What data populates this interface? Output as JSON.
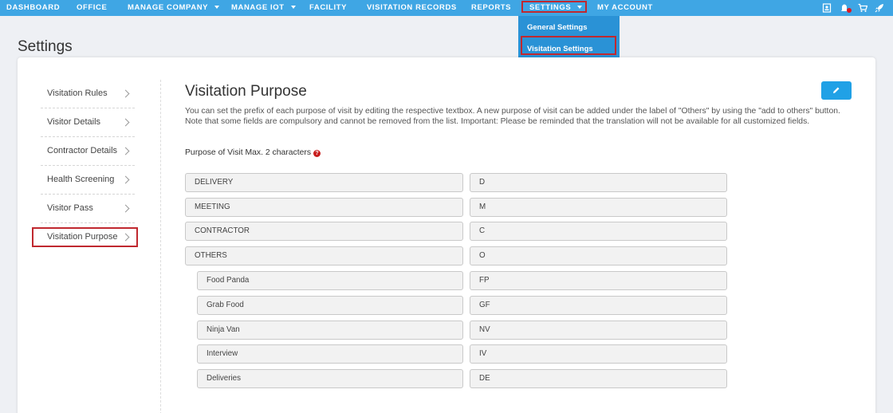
{
  "nav": {
    "items": [
      {
        "label": "DASHBOARD"
      },
      {
        "label": "OFFICE"
      },
      {
        "label": "MANAGE COMPANY"
      },
      {
        "label": "MANAGE IOT"
      },
      {
        "label": "FACILITY"
      },
      {
        "label": "VISITATION RECORDS"
      },
      {
        "label": "REPORTS"
      },
      {
        "label": "SETTINGS"
      },
      {
        "label": "MY ACCOUNT"
      }
    ],
    "icons": [
      "badge-icon",
      "notification-bell-icon",
      "cart-icon",
      "rocket-icon"
    ],
    "accent_color": "#3fa6e4",
    "dropdown": {
      "items": [
        {
          "label": "General Settings"
        },
        {
          "label": "Visitation Settings"
        }
      ]
    }
  },
  "page": {
    "title": "Settings"
  },
  "sidebar": {
    "items": [
      {
        "label": "Visitation Rules"
      },
      {
        "label": "Visitor Details"
      },
      {
        "label": "Contractor Details"
      },
      {
        "label": "Health Screening"
      },
      {
        "label": "Visitor Pass"
      },
      {
        "label": "Visitation Purpose"
      }
    ],
    "active": "Visitation Purpose"
  },
  "main": {
    "title": "Visitation Purpose",
    "edit_button_icon": "pencil-icon",
    "description": "You can set the prefix of each purpose of visit by editing the respective textbox. A new purpose of visit can be added under the label of \"Others\" by using the \"add to others\" button. Note that some fields are compulsory and cannot be removed from the list. Important: Please be reminded that the translation will not be available for all customized fields.",
    "field_label": "Purpose of Visit Max. 2 characters",
    "help_icon": "?",
    "purposes": [
      {
        "name": "DELIVERY",
        "code": "D"
      },
      {
        "name": "MEETING",
        "code": "M"
      },
      {
        "name": "CONTRACTOR",
        "code": "C"
      },
      {
        "name": "OTHERS",
        "code": "O"
      },
      {
        "name": "Food Panda",
        "code": "FP"
      },
      {
        "name": "Grab Food",
        "code": "GF"
      },
      {
        "name": "Ninja Van",
        "code": "NV"
      },
      {
        "name": "Interview",
        "code": "IV"
      },
      {
        "name": "Deliveries",
        "code": "DE"
      }
    ]
  }
}
